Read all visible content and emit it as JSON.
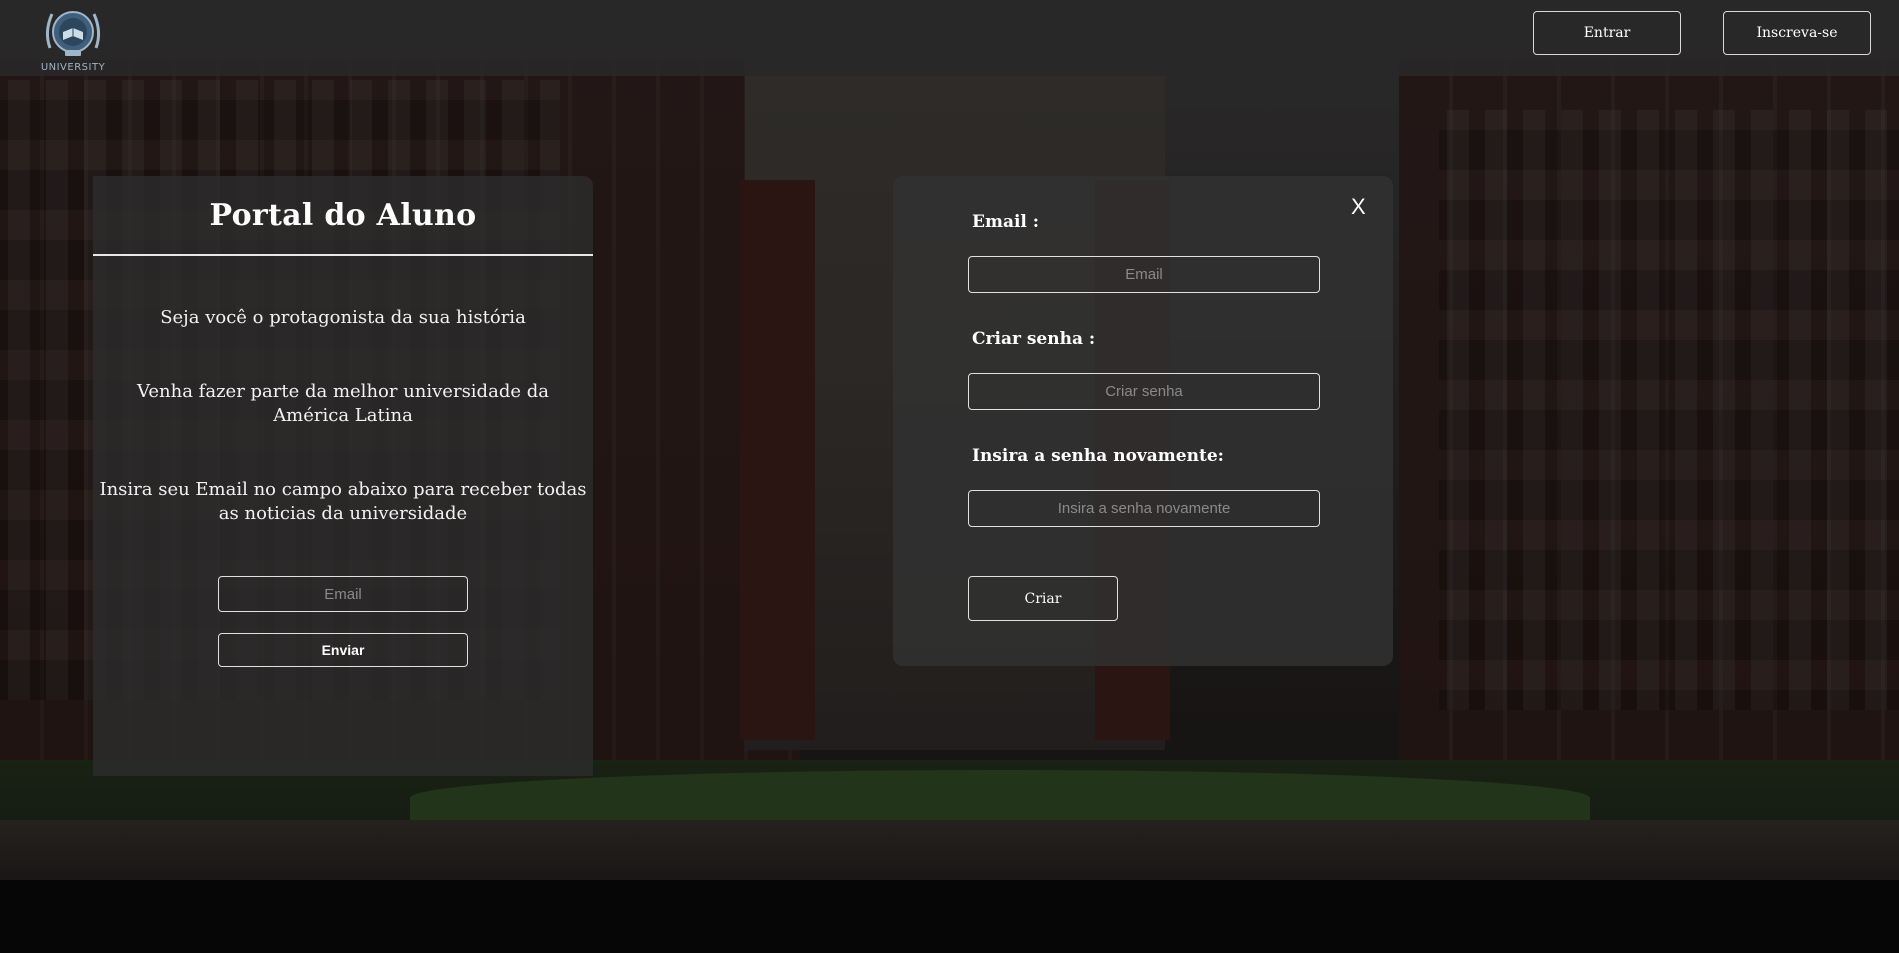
{
  "header": {
    "logo_text": "UNIVERSITY",
    "login_label": "Entrar",
    "signup_label": "Inscreva-se"
  },
  "portal": {
    "title": "Portal do Aluno",
    "line1": "Seja você o protagonista da sua história",
    "line2": "Venha fazer parte da melhor universidade da América Latina",
    "line3": "Insira seu Email no campo abaixo para receber todas as noticias da universidade",
    "email_placeholder": "Email",
    "submit_label": "Enviar"
  },
  "signup_modal": {
    "close_label": "X",
    "email_label": "Email :",
    "email_placeholder": "Email",
    "password_label": "Criar senha :",
    "password_placeholder": "Criar senha",
    "confirm_label": "Insira a senha novamente:",
    "confirm_placeholder": "Insira a senha novamente",
    "create_label": "Criar"
  },
  "colors": {
    "header_bg": "#282828",
    "panel_bg": "#2d2d2d",
    "text": "#ffffff",
    "border": "#e0e0e0",
    "placeholder": "#8a8a8a"
  }
}
